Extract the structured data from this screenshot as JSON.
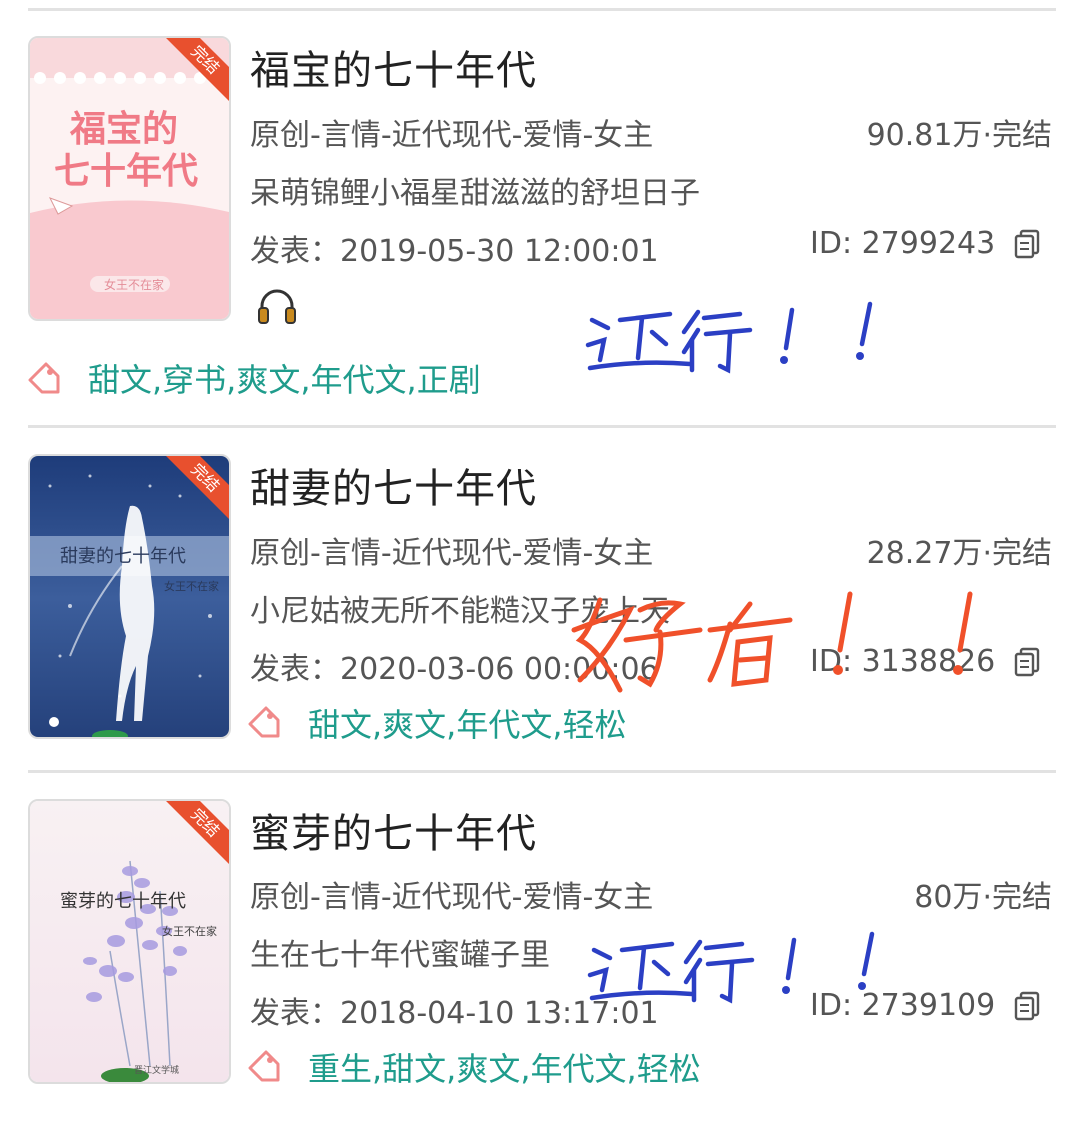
{
  "books": [
    {
      "title": "福宝的七十年代",
      "category": "原创-言情-近代现代-爱情-女主",
      "stats": "90.81万·完结",
      "intro": "呆萌锦鲤小福星甜滋滋的舒坦日子",
      "published": "发表：2019-05-30 12:00:01",
      "id": "ID: 2799243",
      "tags": "甜文,穿书,爽文,年代文,正剧",
      "cover_badge": "完结",
      "cover_title_line1": "福宝的",
      "cover_title_line2": "七十年代",
      "cover_author": "女王不在家"
    },
    {
      "title": "甜妻的七十年代",
      "category": "原创-言情-近代现代-爱情-女主",
      "stats": "28.27万·完结",
      "intro": "小尼姑被无所不能糙汉子宠上天",
      "published": "发表：2020-03-06 00:00:06",
      "id": "ID: 3138826",
      "tags": "甜文,爽文,年代文,轻松",
      "cover_badge": "完结",
      "cover_title": "甜妻的七十年代",
      "cover_author": "女王不在家"
    },
    {
      "title": "蜜芽的七十年代",
      "category": "原创-言情-近代现代-爱情-女主",
      "stats": "80万·完结",
      "intro": "生在七十年代蜜罐子里",
      "published": "发表：2018-04-10 13:17:01",
      "id": "ID: 2739109",
      "tags": "重生,甜文,爽文,年代文,轻松",
      "cover_badge": "完结",
      "cover_title": "蜜芽的七十年代",
      "cover_author": "女王不在家",
      "cover_publisher": "晋江文学城"
    }
  ],
  "annotations": [
    {
      "text": "还行！！",
      "color": "#2b3fc4"
    },
    {
      "text": "好看！！",
      "color": "#f0502a"
    },
    {
      "text": "还行！！",
      "color": "#2b3fc4"
    }
  ],
  "colors": {
    "tag_text": "#1f9c8c",
    "tag_icon": "#f08a8a",
    "badge": "#e8502e",
    "headphone": "#c98a1e"
  },
  "icons": [
    "copy-icon",
    "tag-icon",
    "headphone-icon"
  ]
}
